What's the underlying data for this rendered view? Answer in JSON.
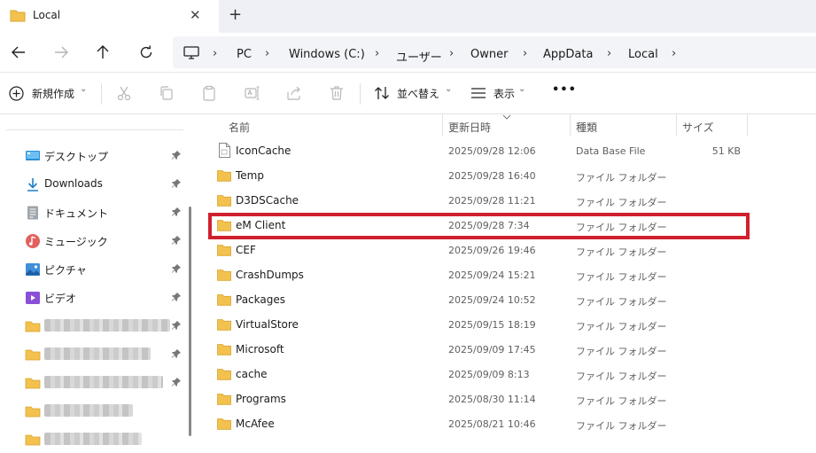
{
  "tab": {
    "title": "Local",
    "close": "✕",
    "new": "+"
  },
  "address": {
    "crumbs": [
      "PC",
      "Windows (C:)",
      "ユーザー",
      "Owner",
      "AppData",
      "Local"
    ],
    "separator": "›"
  },
  "toolbar": {
    "new_label": "新規作成",
    "sort_label": "並べ替え",
    "view_label": "表示",
    "more_label": "•••",
    "chevron": "⌄"
  },
  "sidebar": {
    "items": [
      {
        "label": "デスクトップ",
        "icon": "desktop-icon"
      },
      {
        "label": "Downloads",
        "icon": "downloads-icon"
      },
      {
        "label": "ドキュメント",
        "icon": "documents-icon"
      },
      {
        "label": "ミュージック",
        "icon": "music-icon"
      },
      {
        "label": "ピクチャ",
        "icon": "pictures-icon"
      },
      {
        "label": "ビデオ",
        "icon": "videos-icon"
      }
    ]
  },
  "columns": {
    "name": "名前",
    "date": "更新日時",
    "type": "種類",
    "size": "サイズ"
  },
  "files": [
    {
      "name": "IconCache",
      "date": "2025/09/28 12:06",
      "type": "Data Base File",
      "size": "51 KB",
      "icon": "file-icon"
    },
    {
      "name": "Temp",
      "date": "2025/09/28 16:40",
      "type": "ファイル フォルダー",
      "size": "",
      "icon": "folder-icon"
    },
    {
      "name": "D3DSCache",
      "date": "2025/09/28 11:21",
      "type": "ファイル フォルダー",
      "size": "",
      "icon": "folder-icon"
    },
    {
      "name": "eM Client",
      "date": "2025/09/28 7:34",
      "type": "ファイル フォルダー",
      "size": "",
      "icon": "folder-icon"
    },
    {
      "name": "CEF",
      "date": "2025/09/26 19:46",
      "type": "ファイル フォルダー",
      "size": "",
      "icon": "folder-icon"
    },
    {
      "name": "CrashDumps",
      "date": "2025/09/24 15:21",
      "type": "ファイル フォルダー",
      "size": "",
      "icon": "folder-icon"
    },
    {
      "name": "Packages",
      "date": "2025/09/24 10:52",
      "type": "ファイル フォルダー",
      "size": "",
      "icon": "folder-icon"
    },
    {
      "name": "VirtualStore",
      "date": "2025/09/15 18:19",
      "type": "ファイル フォルダー",
      "size": "",
      "icon": "folder-icon"
    },
    {
      "name": "Microsoft",
      "date": "2025/09/09 17:45",
      "type": "ファイル フォルダー",
      "size": "",
      "icon": "folder-icon"
    },
    {
      "name": "cache",
      "date": "2025/09/09 8:13",
      "type": "ファイル フォルダー",
      "size": "",
      "icon": "folder-icon"
    },
    {
      "name": "Programs",
      "date": "2025/08/30 11:14",
      "type": "ファイル フォルダー",
      "size": "",
      "icon": "folder-icon"
    },
    {
      "name": "McAfee",
      "date": "2025/08/21 10:46",
      "type": "ファイル フォルダー",
      "size": "",
      "icon": "folder-icon"
    }
  ],
  "colors": {
    "highlight": "#d0202e",
    "folder": "#f2c14e"
  }
}
